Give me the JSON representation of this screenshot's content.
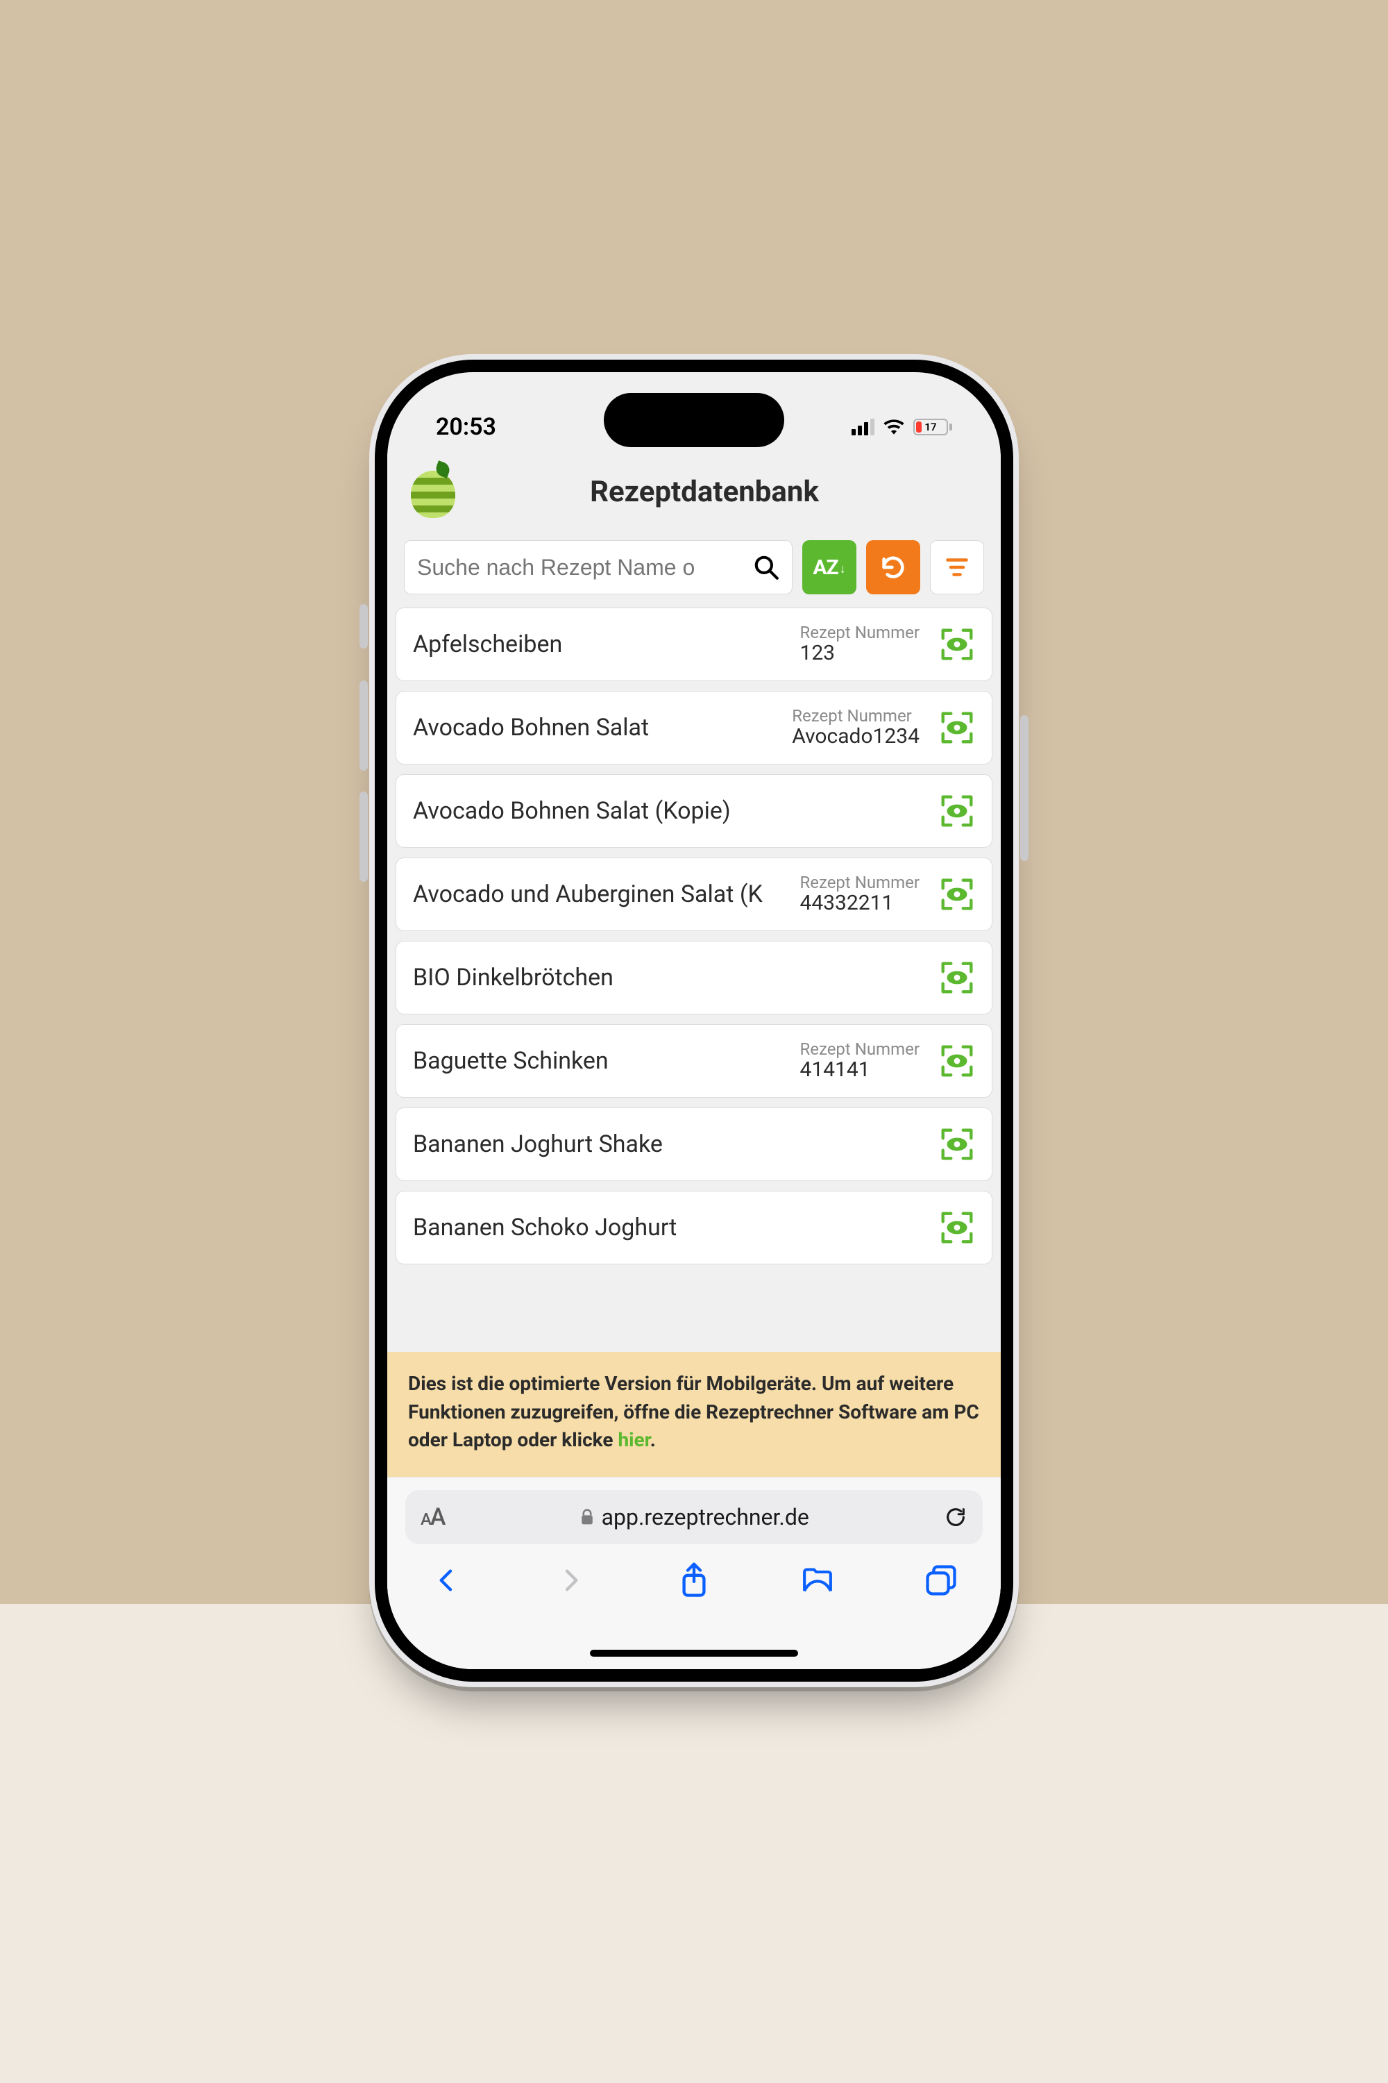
{
  "status": {
    "time": "20:53",
    "battery_pct": "17"
  },
  "app": {
    "title": "Rezeptdatenbank",
    "search_placeholder": "Suche nach Rezept Name o",
    "sort_label": "AZ"
  },
  "recipe_number_label": "Rezept Nummer",
  "recipes": [
    {
      "name": "Apfelscheiben",
      "num": "123"
    },
    {
      "name": "Avocado Bohnen Salat",
      "num": "Avocado1234"
    },
    {
      "name": "Avocado Bohnen Salat (Kopie)",
      "num": ""
    },
    {
      "name": "Avocado und Auberginen Salat (K",
      "num": "44332211"
    },
    {
      "name": "BIO Dinkelbrötchen",
      "num": ""
    },
    {
      "name": "Baguette Schinken",
      "num": "414141"
    },
    {
      "name": "Bananen Joghurt Shake",
      "num": ""
    },
    {
      "name": "Bananen Schoko Joghurt",
      "num": ""
    }
  ],
  "banner": {
    "text_a": "Dies ist die optimierte Version für Mobilgeräte. Um auf weitere Funktionen zuzugreifen, öffne die Rezeptrechner Software am PC oder Laptop oder klicke ",
    "link": "hier",
    "text_b": "."
  },
  "browser": {
    "url": "app.rezeptrechner.de"
  }
}
